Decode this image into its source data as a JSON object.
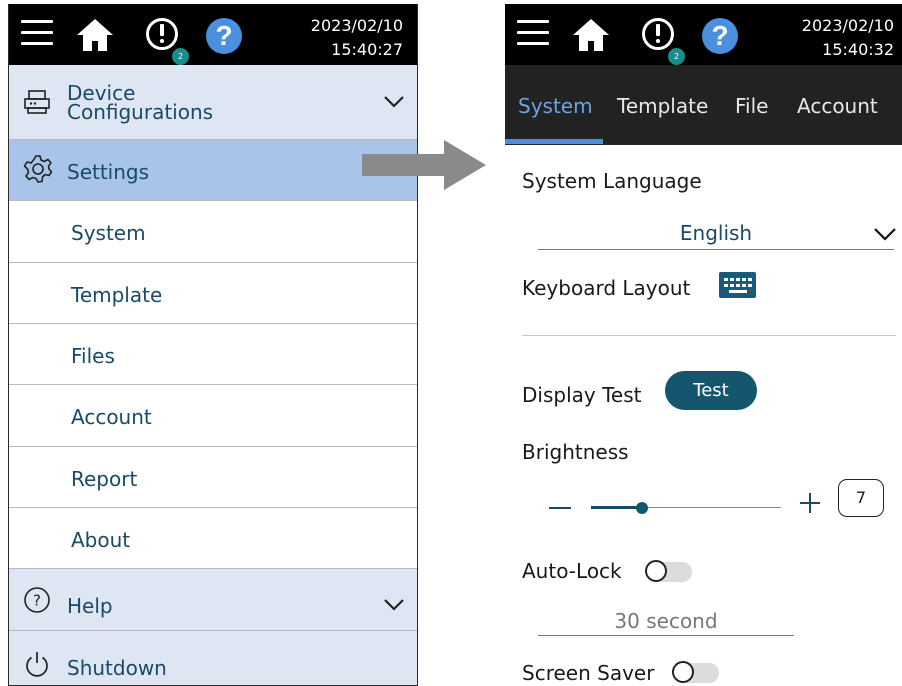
{
  "left_panel": {
    "clock": {
      "date": "2023/02/10",
      "time": "15:40:27"
    },
    "notification_count": "2",
    "menu": {
      "device_config": "Device\nConfigurations",
      "settings": "Settings",
      "sub_items": [
        "System",
        "Template",
        "Files",
        "Account",
        "Report",
        "About"
      ],
      "help": "Help",
      "shutdown": "Shutdown"
    }
  },
  "right_panel": {
    "clock": {
      "date": "2023/02/10",
      "time": "15:40:32"
    },
    "notification_count": "2",
    "tabs": [
      "System",
      "Template",
      "File",
      "Account"
    ],
    "active_tab": "System",
    "settings": {
      "system_language_label": "System Language",
      "system_language_value": "English",
      "keyboard_layout_label": "Keyboard Layout",
      "display_test_label": "Display Test",
      "test_button": "Test",
      "brightness_label": "Brightness",
      "brightness_value": "7",
      "brightness_level": 0.27,
      "auto_lock_label": "Auto-Lock",
      "auto_lock_enabled": false,
      "auto_lock_timeout": "30 second",
      "screen_saver_label": "Screen Saver",
      "screen_saver_enabled": false
    }
  },
  "icons": {
    "menu": "hamburger-icon",
    "home": "home-icon",
    "alert": "alert-icon",
    "help": "help-icon",
    "device": "printer-icon",
    "settings": "gear-icon",
    "help_circle": "question-circle-icon",
    "power": "power-icon",
    "expand": "chevron-down-icon",
    "keyboard": "keyboard-icon",
    "transition": "arrow-right-icon"
  },
  "colors": {
    "topbar": "#000000",
    "menu_light": "#dde6f2",
    "menu_selected": "#a9c4e9",
    "menu_text": "#1a4a66",
    "tab_bar": "#222222",
    "tab_active": "#6aa3ea",
    "primary_button": "#14566e"
  }
}
